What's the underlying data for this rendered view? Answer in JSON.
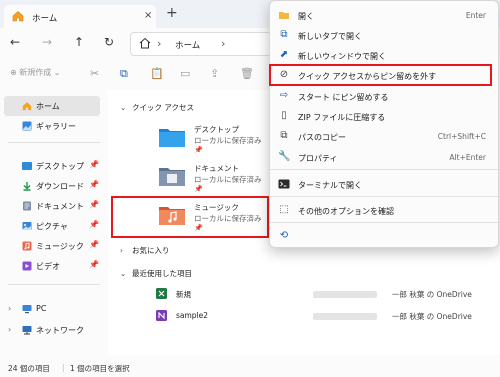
{
  "window": {
    "tab_title": "ホーム",
    "tab_close": "×",
    "new_tab": "+"
  },
  "address": {
    "crumb": "ホーム",
    "sep": "›"
  },
  "toolbar": {
    "new_label": "⊕ 新規作成 ⌄"
  },
  "sidebar": {
    "items": [
      {
        "label": "ホーム",
        "icon": "home-icon"
      },
      {
        "label": "ギャラリー",
        "icon": "gallery-icon"
      },
      {
        "label": "デスクトップ",
        "icon": "desktop-folder-icon"
      },
      {
        "label": "ダウンロード",
        "icon": "download-icon"
      },
      {
        "label": "ドキュメント",
        "icon": "document-folder-icon"
      },
      {
        "label": "ピクチャ",
        "icon": "pictures-folder-icon"
      },
      {
        "label": "ミュージック",
        "icon": "music-folder-icon"
      },
      {
        "label": "ビデオ",
        "icon": "video-folder-icon"
      },
      {
        "label": "PC",
        "icon": "pc-icon"
      },
      {
        "label": "ネットワーク",
        "icon": "network-icon"
      }
    ]
  },
  "main": {
    "quick_access_header": "クイック アクセス",
    "favorites_header": "お気に入り",
    "recent_header": "最近使用した項目",
    "folders": [
      {
        "name": "デスクトップ",
        "location": "ローカルに保存済み"
      },
      {
        "name": "ドキュメント",
        "location": "ローカルに保存済み"
      },
      {
        "name": "ミュージック",
        "location": "ローカルに保存済み"
      }
    ],
    "recent": [
      {
        "name": "新規",
        "owner": "一郎 秋葉 の OneDrive",
        "type": "excel"
      },
      {
        "name": "sample2",
        "owner": "一郎 秋葉 の OneDrive",
        "type": "onenote"
      }
    ]
  },
  "status": {
    "count": "24 個の項目",
    "selected": "1 個の項目を選択"
  },
  "context_menu": {
    "items": [
      {
        "label": "開く",
        "shortcut": "Enter"
      },
      {
        "label": "新しいタブで開く",
        "shortcut": ""
      },
      {
        "label": "新しいウィンドウで開く",
        "shortcut": ""
      },
      {
        "label": "クイック アクセスからピン留めを外す",
        "shortcut": ""
      },
      {
        "label": "スタート にピン留めする",
        "shortcut": ""
      },
      {
        "label": "ZIP ファイルに圧縮する",
        "shortcut": ""
      },
      {
        "label": "パスのコピー",
        "shortcut": "Ctrl+Shift+C"
      },
      {
        "label": "プロパティ",
        "shortcut": "Alt+Enter"
      },
      {
        "label": "ターミナルで開く",
        "shortcut": ""
      },
      {
        "label": "その他のオプションを確認",
        "shortcut": ""
      }
    ]
  },
  "colors": {
    "highlight": "#e5191d",
    "accent": "#1f5fb3"
  }
}
